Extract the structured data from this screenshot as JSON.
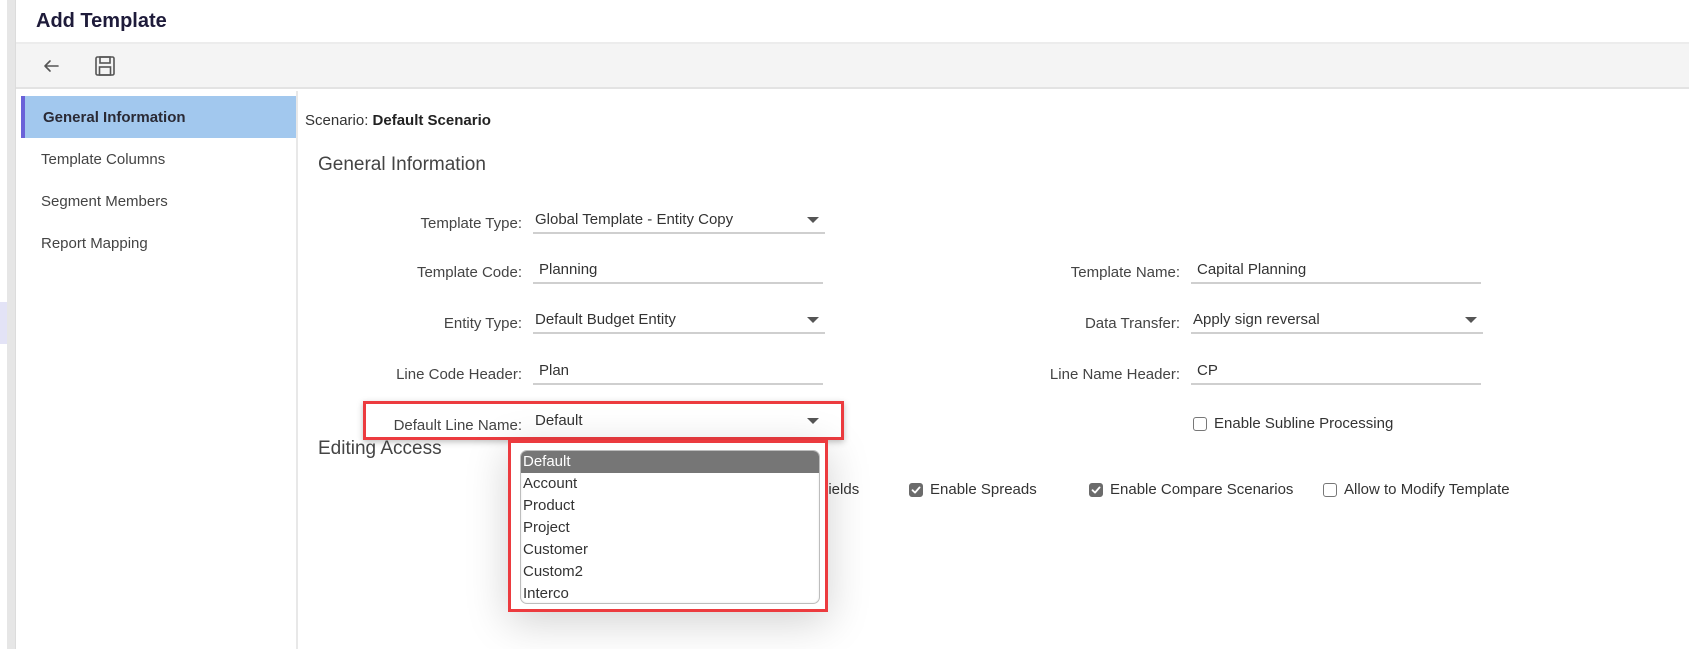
{
  "window": {
    "title": "Add Template"
  },
  "toolbar": {
    "back_icon": "arrow-left-icon",
    "save_icon": "floppy-disk-icon"
  },
  "sidebar": {
    "items": [
      {
        "label": "General Information",
        "active": true
      },
      {
        "label": "Template Columns",
        "active": false
      },
      {
        "label": "Segment Members",
        "active": false
      },
      {
        "label": "Report Mapping",
        "active": false
      }
    ]
  },
  "main": {
    "scenario_label": "Scenario:",
    "scenario_value": "Default Scenario",
    "general_section_title": "General Information",
    "editing_section_title": "Editing Access",
    "fields": {
      "template_type": {
        "label": "Template Type:",
        "value": "Global Template - Entity Copy",
        "kind": "select"
      },
      "template_code": {
        "label": "Template Code:",
        "value": "Planning",
        "kind": "text"
      },
      "template_name": {
        "label": "Template Name:",
        "value": "Capital Planning",
        "kind": "text"
      },
      "entity_type": {
        "label": "Entity Type:",
        "value": "Default Budget Entity",
        "kind": "select"
      },
      "data_transfer": {
        "label": "Data Transfer:",
        "value": "Apply sign reversal",
        "kind": "select"
      },
      "line_code_header": {
        "label": "Line Code Header:",
        "value": "Plan",
        "kind": "text"
      },
      "line_name_header": {
        "label": "Line Name Header:",
        "value": "CP",
        "kind": "text"
      },
      "default_line_name": {
        "label": "Default Line Name:",
        "value": "Default",
        "kind": "select"
      }
    },
    "enable_subline": {
      "label": "Enable Subline Processing",
      "checked": false
    },
    "editing_access": [
      {
        "label": "bal Fields",
        "checked": null
      },
      {
        "label": "Enable Spreads",
        "checked": true
      },
      {
        "label": "Enable Compare Scenarios",
        "checked": true
      },
      {
        "label": "Allow to Modify Template",
        "checked": false
      }
    ]
  },
  "dropdown": {
    "options": [
      "Default",
      "Account",
      "Product",
      "Project",
      "Customer",
      "Custom2",
      "Interco"
    ],
    "selected": "Default"
  },
  "colors": {
    "highlight": "#ec3b3f",
    "sidebar_active_bg": "#a2c8ee",
    "sidebar_active_accent": "#6a62d8",
    "dropdown_selected_bg": "#767676"
  }
}
